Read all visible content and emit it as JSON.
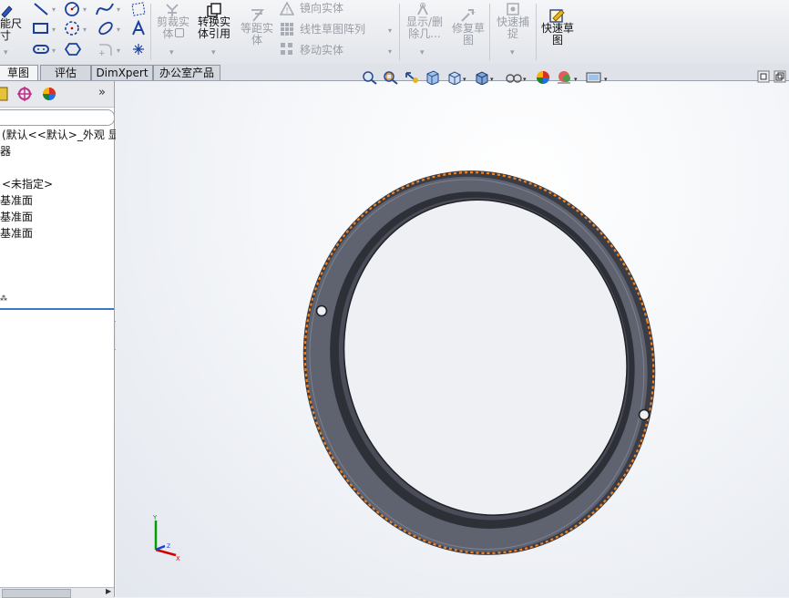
{
  "toolbar": {
    "smart_dim": [
      "能尺",
      "寸"
    ],
    "trim": [
      "剪裁实",
      "体"
    ],
    "convert": [
      "转换实",
      "体引用"
    ],
    "offset": [
      "等距实",
      "体"
    ],
    "mirror": "镜向实体",
    "linear_pattern": "线性草图阵列",
    "move": "移动实体",
    "show_delete": [
      "显示/删",
      "除几..."
    ],
    "repair": [
      "修复草",
      "图"
    ],
    "quick_snap": [
      "快速捕",
      "捉"
    ],
    "quick_sketch": [
      "快速草",
      "图"
    ]
  },
  "tabs": [
    "草图",
    "评估",
    "DimXpert",
    "办公室产品"
  ],
  "tree": {
    "root": "(默认<<默认>_外观 显示",
    "sensors": "器",
    "material": "<未指定>",
    "planes": [
      "基准面",
      "基准面",
      "基准面"
    ]
  },
  "icons": [
    "smart-dimension-icon",
    "line-icon",
    "circle-icon",
    "spline-icon",
    "rectangle-icon",
    "polygon-icon",
    "ellipse-icon",
    "text-icon",
    "point-icon",
    "trim-icon",
    "convert-icon",
    "offset-icon",
    "mirror-icon",
    "pattern-icon",
    "move-icon",
    "show-relations-icon",
    "repair-icon",
    "snap-icon",
    "quick-sketch-icon",
    "zoom-fit-icon",
    "zoom-area-icon",
    "previous-view-icon",
    "section-view-icon",
    "view-orientation-icon",
    "display-style-icon",
    "hide-show-icon",
    "appearance-icon",
    "scene-icon",
    "display-icon",
    "minimize-icon",
    "restore-icon"
  ],
  "colors": {
    "ring": "#5f6370",
    "ring_dark": "#3a3d46",
    "edge_highlight": "#f58220",
    "triad_x": "#d40000",
    "triad_y": "#00a000",
    "triad_z": "#1c3fd8"
  }
}
